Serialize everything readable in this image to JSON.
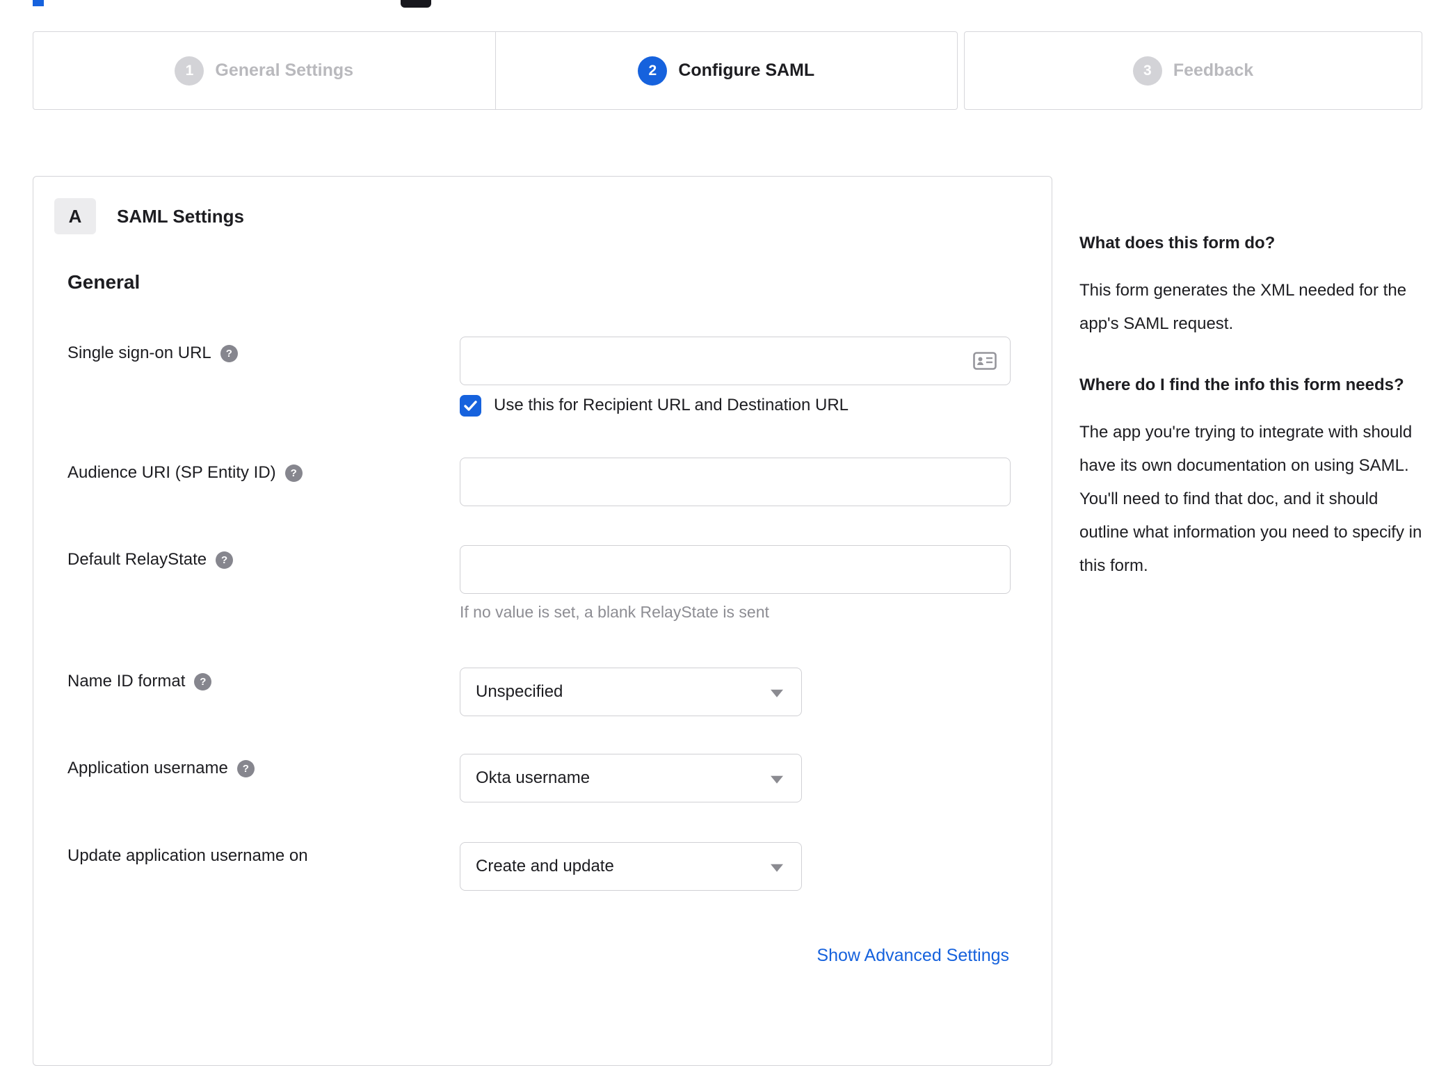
{
  "colors": {
    "accent": "#1662dd",
    "link": "#1662dd"
  },
  "stepper": {
    "steps": [
      {
        "number": "1",
        "label": "General Settings"
      },
      {
        "number": "2",
        "label": "Configure SAML"
      },
      {
        "number": "3",
        "label": "Feedback"
      }
    ]
  },
  "panel": {
    "badge": "A",
    "title": "SAML Settings",
    "general_heading": "General",
    "sso": {
      "label": "Single sign-on URL",
      "value": "",
      "checkbox_label": "Use this for Recipient URL and Destination URL",
      "checkbox_checked": true
    },
    "audience": {
      "label": "Audience URI (SP Entity ID)",
      "value": ""
    },
    "relay_state": {
      "label": "Default RelayState",
      "value": "",
      "hint": "If no value is set, a blank RelayState is sent"
    },
    "name_id_format": {
      "label": "Name ID format",
      "value": "Unspecified"
    },
    "app_username": {
      "label": "Application username",
      "value": "Okta username"
    },
    "update_username": {
      "label": "Update application username on",
      "value": "Create and update"
    },
    "advanced_link": "Show Advanced Settings"
  },
  "help_panel": {
    "q1": "What does this form do?",
    "a1": "This form generates the XML needed for the app's SAML request.",
    "q2": "Where do I find the info this form needs?",
    "a2": "The app you're trying to integrate with should have its own documentation on using SAML. You'll need to find that doc, and it should outline what information you need to specify in this form."
  },
  "icons": {
    "help_glyph": "?"
  }
}
